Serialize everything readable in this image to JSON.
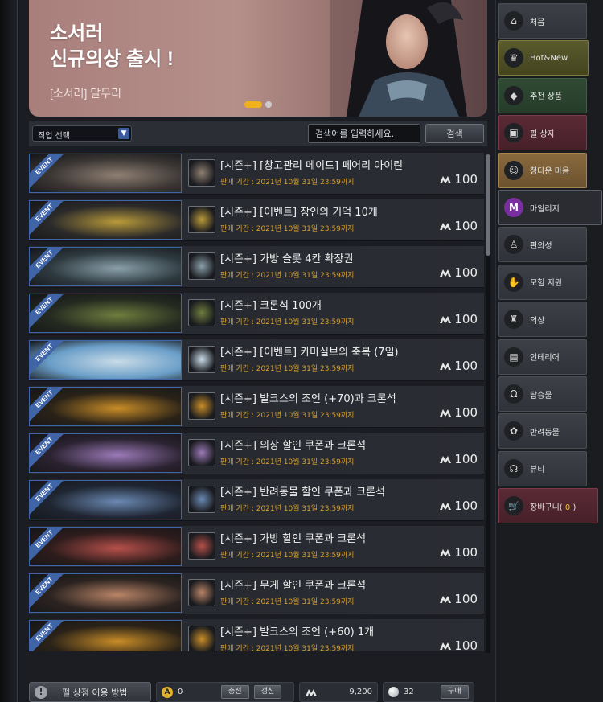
{
  "banner": {
    "title": "소서러\n신규의상 출시 !",
    "subtitle": "[소서러] 달무리"
  },
  "filter": {
    "job_select": "직업 선택",
    "search_placeholder": "검색어를 입력하세요.",
    "search_button": "검색"
  },
  "period_label": "판매 기간 : 2021년 10월 31일 23:59까지",
  "products": [
    {
      "name": "[시즌+] [창고관리 메이드] 페어리 아이린",
      "price": "100",
      "theme": "maid"
    },
    {
      "name": "[시즌+] [이벤트] 장인의 기억 10개",
      "price": "100",
      "theme": "gold"
    },
    {
      "name": "[시즌+] 가방 슬롯 4칸 확장권",
      "price": "100",
      "theme": "bag"
    },
    {
      "name": "[시즌+] 크론석 100개",
      "price": "100",
      "theme": "green"
    },
    {
      "name": "[시즌+] [이벤트] 카마실브의 축복 (7일)",
      "price": "100",
      "theme": "sky"
    },
    {
      "name": "[시즌+] 발크스의 조언 (+70)과 크론석",
      "price": "100",
      "theme": "orange"
    },
    {
      "name": "[시즌+] 의상 할인 쿠폰과 크론석",
      "price": "100",
      "theme": "purple"
    },
    {
      "name": "[시즌+] 반려동물 할인 쿠폰과 크론석",
      "price": "100",
      "theme": "blue"
    },
    {
      "name": "[시즌+] 가방 할인 쿠폰과 크론석",
      "price": "100",
      "theme": "red"
    },
    {
      "name": "[시즌+] 무게 할인 쿠폰과 크론석",
      "price": "100",
      "theme": "copper"
    },
    {
      "name": "[시즌+] 발크스의 조언 (+60) 1개",
      "price": "100",
      "theme": "orange"
    }
  ],
  "event_tag": "EVENT",
  "bottom": {
    "howto": "펄 상점 이용 방법",
    "acoin": "0",
    "charge": "충전",
    "refresh": "갱신",
    "mileage": "9,200",
    "pearl": "32",
    "buy": "구매"
  },
  "sidebar": [
    {
      "label": "처음",
      "icon": "home-icon",
      "style": ""
    },
    {
      "label": "Hot&New",
      "icon": "trophy-icon",
      "style": "hot"
    },
    {
      "label": "추천 상품",
      "icon": "recommend-icon",
      "style": "rec"
    },
    {
      "label": "펄 상자",
      "icon": "box-icon",
      "style": "pearl"
    },
    {
      "label": "청다운 마음",
      "icon": "face-icon",
      "style": "tan"
    },
    {
      "label": "마일리지",
      "icon": "mileage-icon",
      "style": "active"
    },
    {
      "label": "편의성",
      "icon": "potion-icon",
      "style": ""
    },
    {
      "label": "모험 지원",
      "icon": "thumbs-up-icon",
      "style": ""
    },
    {
      "label": "의상",
      "icon": "costume-icon",
      "style": ""
    },
    {
      "label": "인테리어",
      "icon": "furniture-icon",
      "style": ""
    },
    {
      "label": "탑승물",
      "icon": "horseshoe-icon",
      "style": ""
    },
    {
      "label": "반려동물",
      "icon": "paw-icon",
      "style": ""
    },
    {
      "label": "뷰티",
      "icon": "beauty-icon",
      "style": ""
    }
  ],
  "cart": {
    "label": "장바구니(",
    "count": "0",
    "close": ")"
  }
}
